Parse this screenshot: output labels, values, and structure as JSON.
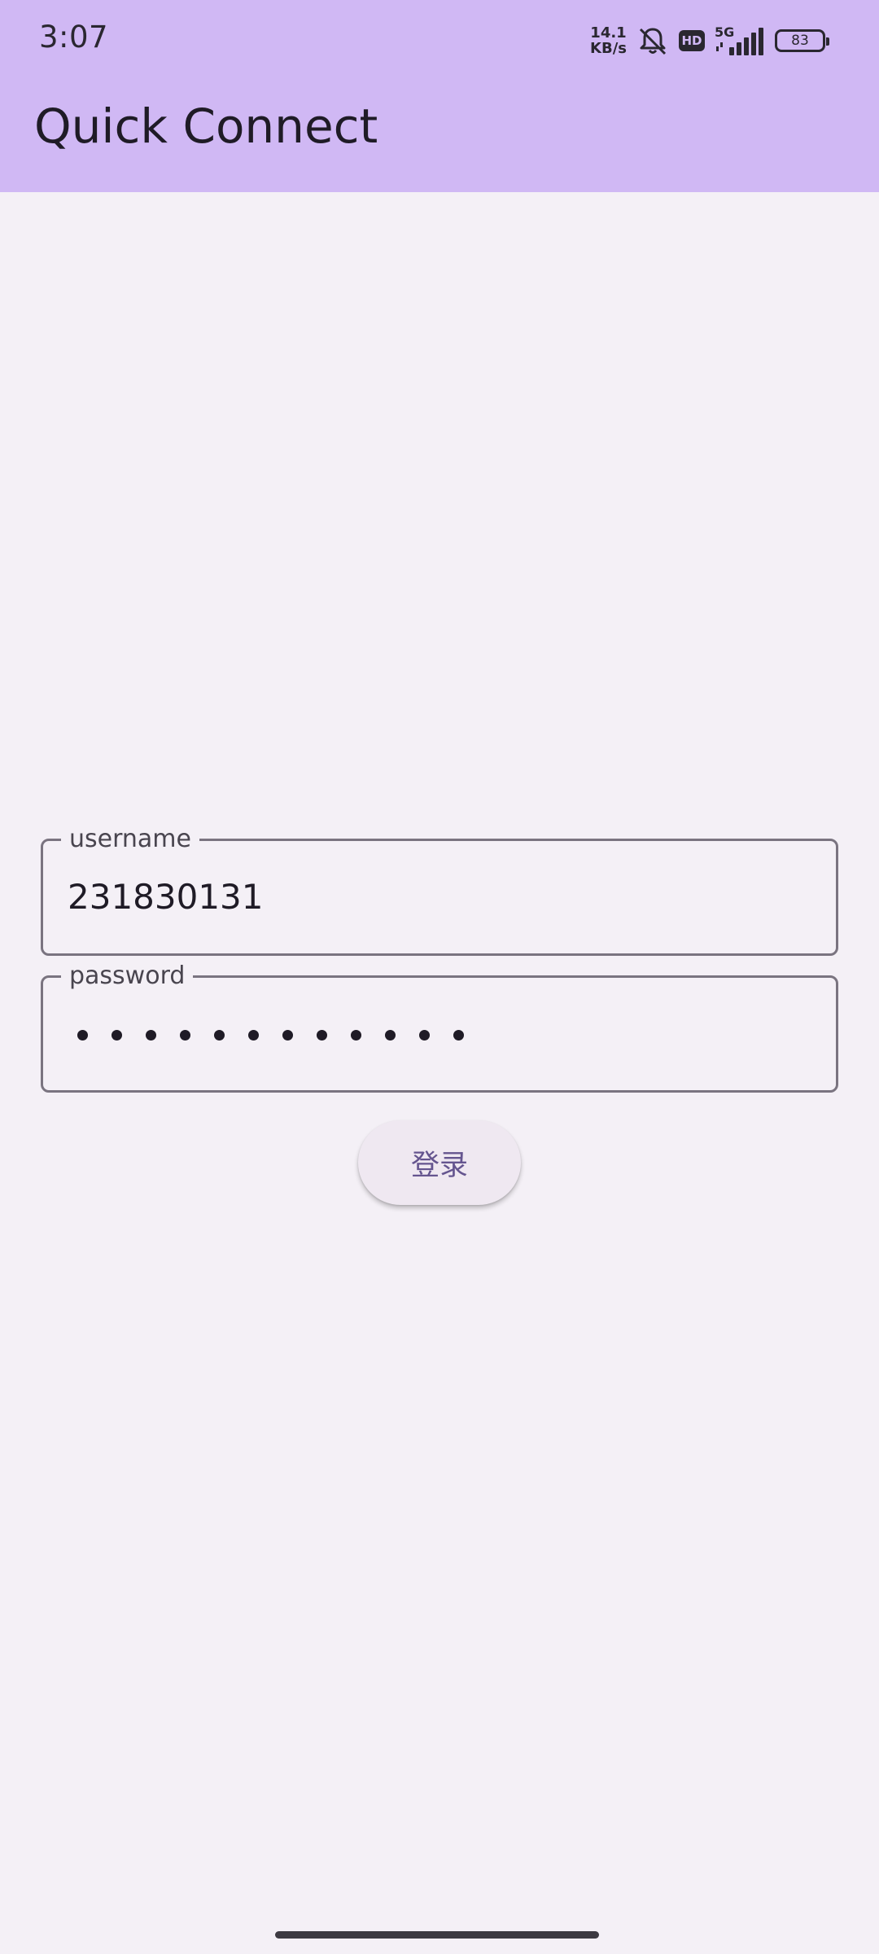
{
  "status_bar": {
    "time": "3:07",
    "net_speed_value": "14.1",
    "net_speed_unit": "KB/s",
    "silent_icon": "bell-off-icon",
    "hd_label": "HD",
    "network_type": "5G",
    "battery_level": "83"
  },
  "app_bar": {
    "title": "Quick Connect",
    "background": "#d0b8f4"
  },
  "form": {
    "username_label": "username",
    "username_value": "231830131",
    "password_label": "password",
    "password_length": 12,
    "login_label": "登录"
  },
  "colors": {
    "accent": "#65558f",
    "background": "#f4f0f6"
  }
}
